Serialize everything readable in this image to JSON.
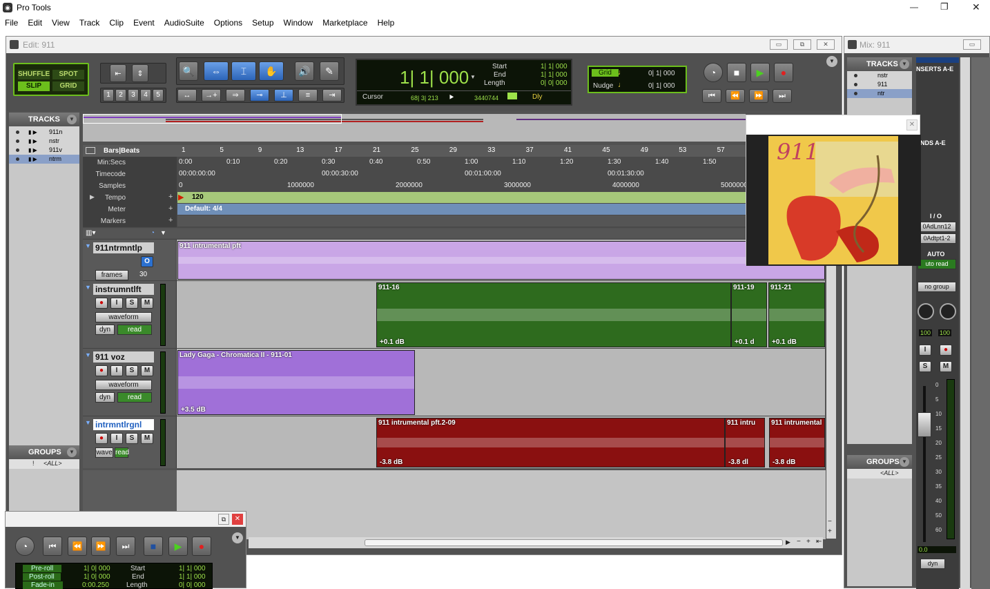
{
  "app": {
    "title": "Pro Tools"
  },
  "menu": [
    "File",
    "Edit",
    "View",
    "Track",
    "Clip",
    "Event",
    "AudioSuite",
    "Options",
    "Setup",
    "Window",
    "Marketplace",
    "Help"
  ],
  "window_controls": {
    "minimize": "—",
    "maximize": "❐",
    "close": "✕"
  },
  "edit_window": {
    "title": "Edit: 911"
  },
  "mix_window": {
    "title": "Mix: 911"
  },
  "modes": {
    "shuffle": "SHUFFLE",
    "spot": "SPOT",
    "slip": "SLIP",
    "grid": "GRID"
  },
  "zoom_presets": [
    "1",
    "2",
    "3",
    "4",
    "5"
  ],
  "counter": {
    "main": "1| 1| 000",
    "cursor_label": "Cursor",
    "cursor_value": "68| 3| 213",
    "samples": "3440744",
    "start_label": "Start",
    "start_value": "1| 1| 000",
    "end_label": "End",
    "end_value": "1| 1| 000",
    "length_label": "Length",
    "length_value": "0| 0| 000",
    "dly": "Dly"
  },
  "grid_nudge": {
    "grid_label": "Grid",
    "grid_value": "0| 1| 000",
    "nudge_label": "Nudge",
    "nudge_value": "0| 1| 000"
  },
  "tracks_panel": {
    "header": "TRACKS",
    "items": [
      {
        "name": "911n",
        "selected": false
      },
      {
        "name": "nstr",
        "selected": false
      },
      {
        "name": "911v",
        "selected": false
      },
      {
        "name": "ntrm",
        "selected": true
      }
    ]
  },
  "groups_panel": {
    "header": "GROUPS",
    "all": "<ALL>",
    "bang": "!"
  },
  "rulers": {
    "bars_label": "Bars|Beats",
    "bars": [
      "1",
      "5",
      "9",
      "13",
      "17",
      "21",
      "25",
      "29",
      "33",
      "37",
      "41",
      "45",
      "49",
      "53",
      "57"
    ],
    "minsecs_label": "Min:Secs",
    "minsecs": [
      "0:00",
      "0:10",
      "0:20",
      "0:30",
      "0:40",
      "0:50",
      "1:00",
      "1:10",
      "1:20",
      "1:30",
      "1:40",
      "1:50"
    ],
    "timecode_label": "Timecode",
    "timecode": [
      "00:00:00:00",
      "00:00:30:00",
      "00:01:00:00",
      "00:01:30:00"
    ],
    "samples_label": "Samples",
    "samples": [
      "0",
      "1000000",
      "2000000",
      "3000000",
      "4000000",
      "5000000"
    ],
    "tempo_label": "Tempo",
    "tempo_value": "120",
    "meter_label": "Meter",
    "meter_value": "Default: 4/4",
    "markers_label": "Markers"
  },
  "edit_tracks": [
    {
      "name": "911ntrmntlp",
      "type": "midi",
      "view": "frames",
      "value": "30",
      "clips": [
        {
          "name": "911 intrumental pft",
          "db": ""
        }
      ]
    },
    {
      "name": "instrumntlft",
      "type": "audio",
      "view": "waveform",
      "auto": "read",
      "dyn": "dyn",
      "clips": [
        {
          "name": "911-16",
          "db": "+0.1 dB"
        },
        {
          "name": "911-19",
          "db": "+0.1 d"
        },
        {
          "name": "911-21",
          "db": "+0.1 dB"
        }
      ]
    },
    {
      "name": "911 voz",
      "type": "audio",
      "view": "waveform",
      "auto": "read",
      "dyn": "dyn",
      "clips": [
        {
          "name": "Lady Gaga - Chromatica II -  911-01",
          "db": "+3.5 dB"
        }
      ]
    },
    {
      "name": "intrmntlrgnl",
      "type": "audio",
      "view": "wave",
      "auto": "read",
      "dyn": "",
      "clips": [
        {
          "name": "911 intrumental pft.2-09",
          "db": "-3.8 dB"
        },
        {
          "name": "911 intru",
          "db": "-3.8 dl"
        },
        {
          "name": "911 intrumental",
          "db": "-3.8 dB"
        }
      ]
    }
  ],
  "track_buttons": {
    "rec": "●",
    "input": "I",
    "solo": "S",
    "mute": "M",
    "online": "O"
  },
  "mix": {
    "tracks_header": "TRACKS",
    "tracks": [
      "nstr",
      "911",
      "ntr"
    ],
    "inserts": "NSERTS A-E",
    "sends": "ENDS A-E",
    "io": "I / O",
    "input": "0AdLnn12",
    "output": "0Adtpt1-2",
    "auto_label": "AUTO",
    "auto_value": "uto read",
    "group": "no group",
    "pan_l": "100",
    "pan_r": "100",
    "scale": [
      "0",
      "5",
      "10",
      "15",
      "20",
      "25",
      "30",
      "35",
      "40",
      "50",
      "60"
    ],
    "fader_value": "0.0",
    "dyn": "dyn",
    "groups_header": "GROUPS",
    "groups_all": "<ALL>"
  },
  "popup": {
    "close": "✕",
    "artwork_text": "911"
  },
  "transport": {
    "preroll_label": "Pre-roll",
    "preroll_value": "1| 0| 000",
    "postroll_label": "Post-roll",
    "postroll_value": "1| 0| 000",
    "fadein_label": "Fade-in",
    "fadein_value": "0:00.250",
    "start_label": "Start",
    "start_value": "1| 1| 000",
    "end_label": "End",
    "end_value": "1| 1| 000",
    "length_label": "Length",
    "length_value": "0| 0| 000"
  },
  "colors": {
    "accent": "#6cbf1c",
    "midi_clip": "#c9a6e6",
    "audio_green": "#2e6b1e",
    "voz_purple": "#a070d8",
    "red_clip": "#8a1010"
  }
}
